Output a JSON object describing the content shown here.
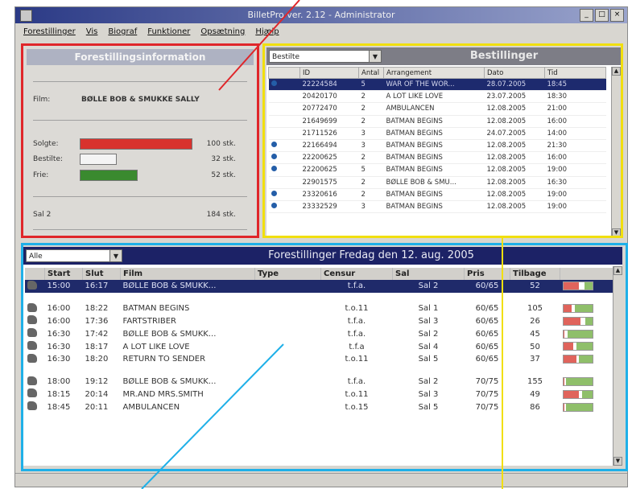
{
  "window": {
    "title": "BilletPro ver. 2.12 - Administrator",
    "controls": [
      "_",
      "□",
      "×"
    ]
  },
  "menu": [
    "Forestillinger",
    "Vis",
    "Biograf",
    "Funktioner",
    "Opsætning",
    "Hjælp"
  ],
  "info_panel": {
    "title": "Forestillingsinformation",
    "film_label": "Film:",
    "film_value": "BØLLE BOB & SMUKKE SALLY",
    "rows": [
      {
        "label": "Solgte:",
        "value": "100 stk.",
        "color": "#d8322e",
        "fraction": 0.53
      },
      {
        "label": "Bestilte:",
        "value": "32 stk.",
        "color": "#f4f4f4",
        "fraction": 0.17
      },
      {
        "label": "Frie:",
        "value": "52 stk.",
        "color": "#3a8a2f",
        "fraction": 0.27
      }
    ],
    "hall_label": "Sal 2",
    "hall_value": "184 stk."
  },
  "bookings": {
    "filter": "Bestilte",
    "title": "Bestillinger",
    "columns": [
      "",
      "ID",
      "Antal",
      "Arrangement",
      "Dato",
      "Tid"
    ],
    "rows": [
      {
        "icon": true,
        "id": "22224584",
        "antal": "5",
        "arr": "WAR OF THE WOR...",
        "dato": "28.07.2005",
        "tid": "18:45",
        "selected": true
      },
      {
        "icon": false,
        "id": "20420170",
        "antal": "2",
        "arr": "A LOT LIKE LOVE",
        "dato": "23.07.2005",
        "tid": "18:30"
      },
      {
        "icon": false,
        "id": "20772470",
        "antal": "2",
        "arr": "AMBULANCEN",
        "dato": "12.08.2005",
        "tid": "21:00"
      },
      {
        "icon": false,
        "id": "21649699",
        "antal": "2",
        "arr": "BATMAN BEGINS",
        "dato": "12.08.2005",
        "tid": "16:00"
      },
      {
        "icon": false,
        "id": "21711526",
        "antal": "3",
        "arr": "BATMAN BEGINS",
        "dato": "24.07.2005",
        "tid": "14:00"
      },
      {
        "icon": true,
        "id": "22166494",
        "antal": "3",
        "arr": "BATMAN BEGINS",
        "dato": "12.08.2005",
        "tid": "21:30"
      },
      {
        "icon": true,
        "id": "22200625",
        "antal": "2",
        "arr": "BATMAN BEGINS",
        "dato": "12.08.2005",
        "tid": "16:00"
      },
      {
        "icon": true,
        "id": "22200625",
        "antal": "5",
        "arr": "BATMAN BEGINS",
        "dato": "12.08.2005",
        "tid": "19:00"
      },
      {
        "icon": false,
        "id": "22901575",
        "antal": "2",
        "arr": "BØLLE BOB & SMU...",
        "dato": "12.08.2005",
        "tid": "16:30"
      },
      {
        "icon": true,
        "id": "23320616",
        "antal": "2",
        "arr": "BATMAN BEGINS",
        "dato": "12.08.2005",
        "tid": "19:00"
      },
      {
        "icon": true,
        "id": "23332529",
        "antal": "3",
        "arr": "BATMAN BEGINS",
        "dato": "12.08.2005",
        "tid": "19:00"
      }
    ]
  },
  "shows": {
    "filter": "Alle",
    "title": "Forestillinger Fredag den 12. aug. 2005",
    "columns": [
      "",
      "Start",
      "Slut",
      "Film",
      "Type",
      "Censur",
      "Sal",
      "Pris",
      "Tilbage",
      ""
    ],
    "rows": [
      {
        "start": "15:00",
        "slut": "16:17",
        "film": "BØLLE BOB & SMUKK...",
        "type": "",
        "censur": "t.f.a.",
        "sal": "Sal 2",
        "pris": "60/65",
        "tilbage": "52",
        "selected": true,
        "sold": 0.55,
        "booked": 0.18
      },
      {
        "gap": true
      },
      {
        "start": "16:00",
        "slut": "18:22",
        "film": "BATMAN BEGINS",
        "type": "",
        "censur": "t.o.11",
        "sal": "Sal 1",
        "pris": "60/65",
        "tilbage": "105",
        "sold": 0.3,
        "booked": 0.1
      },
      {
        "start": "16:00",
        "slut": "17:36",
        "film": "FARTSTRIBER",
        "type": "",
        "censur": "t.f.a.",
        "sal": "Sal 3",
        "pris": "60/65",
        "tilbage": "26",
        "sold": 0.6,
        "booked": 0.15
      },
      {
        "start": "16:30",
        "slut": "17:42",
        "film": "BØLLE BOB & SMUKK...",
        "type": "",
        "censur": "t.f.a.",
        "sal": "Sal 2",
        "pris": "60/65",
        "tilbage": "45",
        "sold": 0.05,
        "booked": 0.1
      },
      {
        "start": "16:30",
        "slut": "18:17",
        "film": "A LOT LIKE LOVE",
        "type": "",
        "censur": "t.f.a",
        "sal": "Sal 4",
        "pris": "60/65",
        "tilbage": "50",
        "sold": 0.35,
        "booked": 0.1
      },
      {
        "start": "16:30",
        "slut": "18:20",
        "film": "RETURN TO SENDER",
        "type": "",
        "censur": "t.o.11",
        "sal": "Sal 5",
        "pris": "60/65",
        "tilbage": "37",
        "sold": 0.45,
        "booked": 0.1
      },
      {
        "gap": true
      },
      {
        "start": "18:00",
        "slut": "19:12",
        "film": "BØLLE BOB & SMUKK...",
        "type": "",
        "censur": "t.f.a.",
        "sal": "Sal 2",
        "pris": "70/75",
        "tilbage": "155",
        "sold": 0.05,
        "booked": 0.05
      },
      {
        "start": "18:15",
        "slut": "20:14",
        "film": "MR.AND MRS.SMITH",
        "type": "",
        "censur": "t.o.11",
        "sal": "Sal 3",
        "pris": "70/75",
        "tilbage": "49",
        "sold": 0.55,
        "booked": 0.1
      },
      {
        "start": "18:45",
        "slut": "20:11",
        "film": "AMBULANCEN",
        "type": "",
        "censur": "t.o.15",
        "sal": "Sal 5",
        "pris": "70/75",
        "tilbage": "86",
        "sold": 0.05,
        "booked": 0.05
      }
    ]
  },
  "colors": {
    "sold": "#e0645c",
    "booked": "#ffffff",
    "free": "#8fbf6a",
    "annotation_red": "#e0262a",
    "annotation_yellow": "#f1df0e",
    "annotation_blue": "#1fb0e8"
  }
}
